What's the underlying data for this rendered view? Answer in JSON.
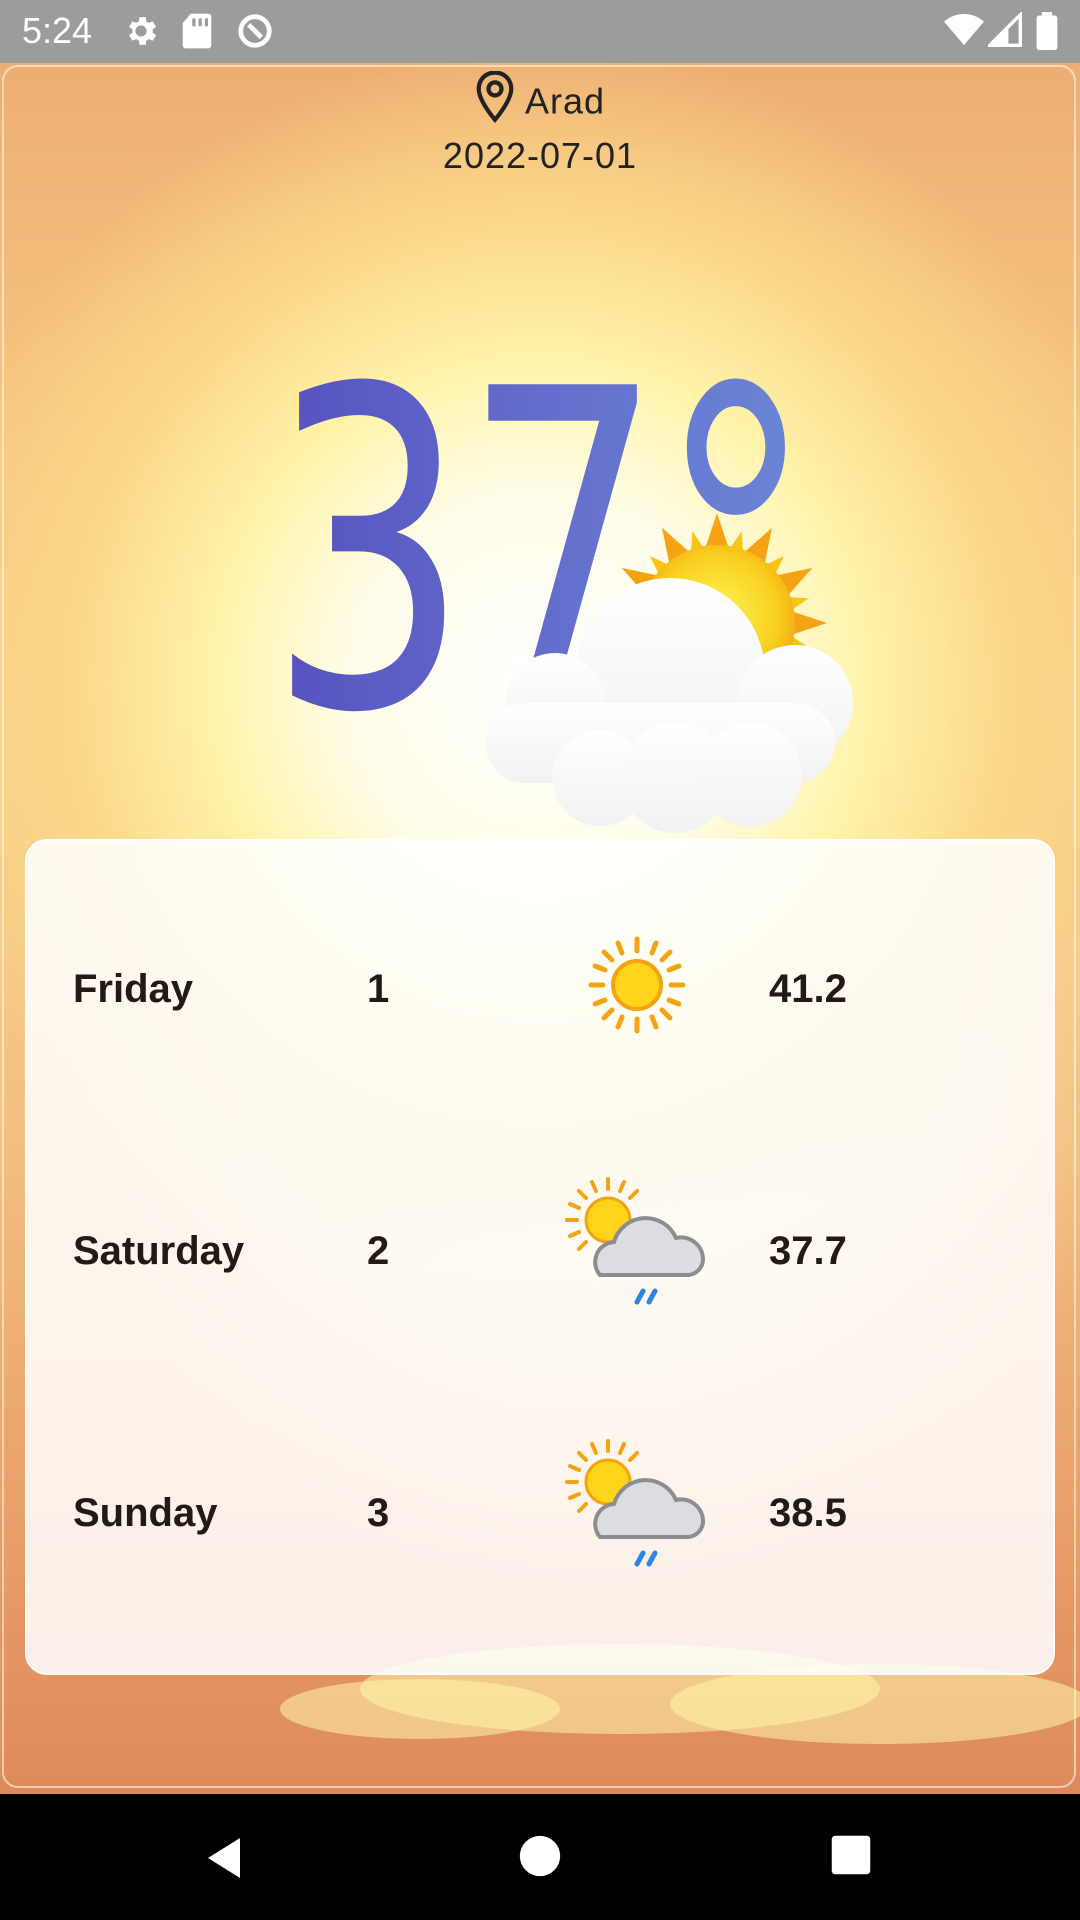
{
  "status_bar": {
    "time": "5:24",
    "left_icons": [
      "settings-icon",
      "sd-card-icon",
      "sync-icon"
    ],
    "right_icons": [
      "wifi-icon",
      "signal-icon",
      "battery-icon"
    ]
  },
  "header": {
    "location_icon": "map-pin-icon",
    "city": "Arad",
    "date": "2022-07-01"
  },
  "current": {
    "temperature": "37°",
    "icon": "sun-behind-cloud-icon"
  },
  "forecast": [
    {
      "day": "Friday",
      "index": "1",
      "icon": "sunny-icon",
      "temp": "41.2"
    },
    {
      "day": "Saturday",
      "index": "2",
      "icon": "partly-cloudy-rain-icon",
      "temp": "37.7"
    },
    {
      "day": "Sunday",
      "index": "3",
      "icon": "partly-cloudy-rain-icon",
      "temp": "38.5"
    }
  ],
  "nav_bar": [
    "back-icon",
    "home-icon",
    "recents-icon"
  ],
  "colors": {
    "status_bar": "#9e9b9b",
    "temp_gradient_start": "#5651bf",
    "temp_gradient_end": "#6a86d6",
    "text": "#231a18"
  }
}
